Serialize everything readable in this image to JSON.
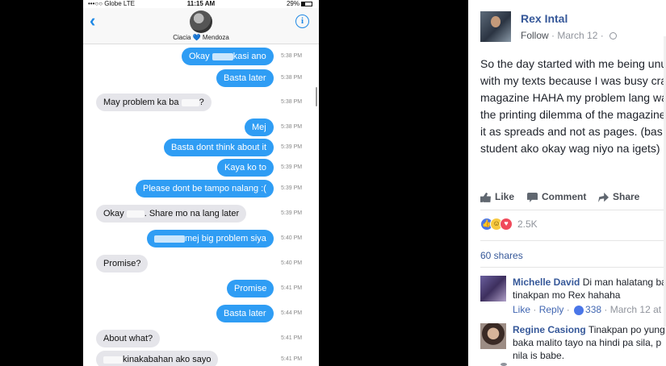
{
  "phone": {
    "status": {
      "carrier": "Globe",
      "network": "LTE",
      "time": "11:15 AM",
      "battery": "29%"
    },
    "contact": {
      "name_left": "Ciacia",
      "heart": "💙",
      "name_right": "Mendoza"
    },
    "messages": [
      {
        "dir": "out",
        "pre": "Okay ",
        "post": "kasi ano",
        "redact_w": 26,
        "time": "5:38 PM"
      },
      {
        "dir": "out",
        "pre": "Basta later",
        "post": "",
        "redact_w": 0,
        "time": "5:38 PM"
      },
      {
        "dir": "in",
        "pre": "May problem ka ba ",
        "post": "?",
        "redact_w": 22,
        "time": "5:38 PM"
      },
      {
        "dir": "out",
        "pre": "Mej",
        "post": "",
        "redact_w": 0,
        "time": "5:38 PM"
      },
      {
        "dir": "out",
        "pre": "Basta dont think about it",
        "post": "",
        "redact_w": 0,
        "time": "5:39 PM"
      },
      {
        "dir": "out",
        "pre": "Kaya ko to",
        "post": "",
        "redact_w": 0,
        "time": "5:39 PM"
      },
      {
        "dir": "out",
        "pre": "Please dont be tampo nalang :(",
        "post": "",
        "redact_w": 0,
        "time": "5:39 PM"
      },
      {
        "dir": "in",
        "pre": "Okay ",
        "post": ". Share mo na lang later",
        "redact_w": 22,
        "time": "5:39 PM"
      },
      {
        "dir": "out",
        "pre": "",
        "post": "mej big problem siya",
        "redact_w": 38,
        "time": "5:40 PM"
      },
      {
        "dir": "in",
        "pre": "Promise?",
        "post": "",
        "redact_w": 0,
        "time": "5:40 PM"
      },
      {
        "dir": "out",
        "pre": "Promise",
        "post": "",
        "redact_w": 0,
        "time": "5:41 PM"
      },
      {
        "dir": "out",
        "pre": "Basta later",
        "post": "",
        "redact_w": 0,
        "time": "5:44 PM"
      },
      {
        "dir": "in",
        "pre": "About what?",
        "post": "",
        "redact_w": 0,
        "time": "5:41 PM"
      },
      {
        "dir": "in",
        "pre": "",
        "post": "kinakabahan ako sayo",
        "redact_w": 24,
        "time": "5:41 PM"
      }
    ]
  },
  "post": {
    "author": "Rex Intal",
    "follow": "Follow",
    "date": "March 12",
    "lines": [
      "So the day started with me being unu",
      "with my texts because I was busy cra",
      "magazine HAHA my problem lang wa",
      "the printing dilemma of the magazine",
      "it as spreads and not as pages. (bas",
      "student ako okay wag niyo na igets)"
    ],
    "actions": {
      "like": "Like",
      "comment": "Comment",
      "share": "Share"
    },
    "reaction_count": "2.5K",
    "shares": "60 shares",
    "comments": [
      {
        "author": "Michelle David",
        "text1": "Di man halatang ba",
        "text2": "tinakpan mo Rex hahaha",
        "like": "Like",
        "reply": "Reply",
        "likes": "338",
        "date": "March 12 at"
      },
      {
        "author": "Regine Casiong",
        "text1": "Tinakpan po yung",
        "text2": "baka malito tayo na hindi pa sila, p",
        "text3": "nila is babe."
      }
    ]
  },
  "colors": {
    "imessage_blue": "#2f9df4",
    "incoming_gray": "#e5e5ea",
    "fb_link": "#365899"
  }
}
